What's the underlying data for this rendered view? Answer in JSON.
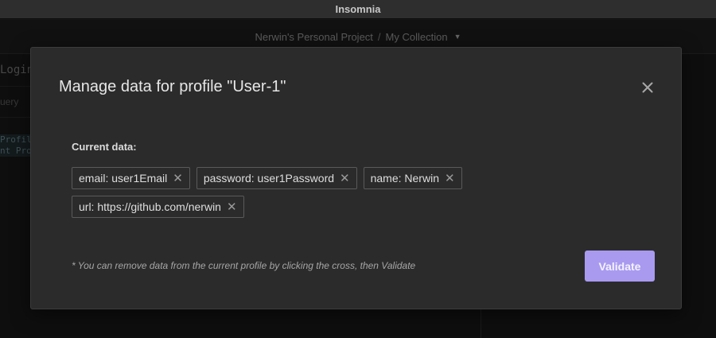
{
  "window": {
    "title": "Insomnia"
  },
  "header": {
    "project": "Nerwin's Personal Project",
    "separator": "/",
    "collection": "My Collection"
  },
  "background": {
    "left_title": "Login",
    "left_query": "uery",
    "code_lines": [
      "Profil",
      "nt Pro"
    ]
  },
  "modal": {
    "title": "Manage data for profile \"User-1\"",
    "current_data_label": "Current data:",
    "tags": [
      {
        "label": "email: user1Email"
      },
      {
        "label": "password: user1Password"
      },
      {
        "label": "name: Nerwin"
      },
      {
        "label": "url: https://github.com/nerwin"
      }
    ],
    "note": "* You can remove data from the current profile by clicking the cross, then Validate",
    "validate_label": "Validate"
  },
  "colors": {
    "accent": "#a99af0",
    "modal_bg": "#2b2b2b",
    "app_bg": "#161616"
  }
}
